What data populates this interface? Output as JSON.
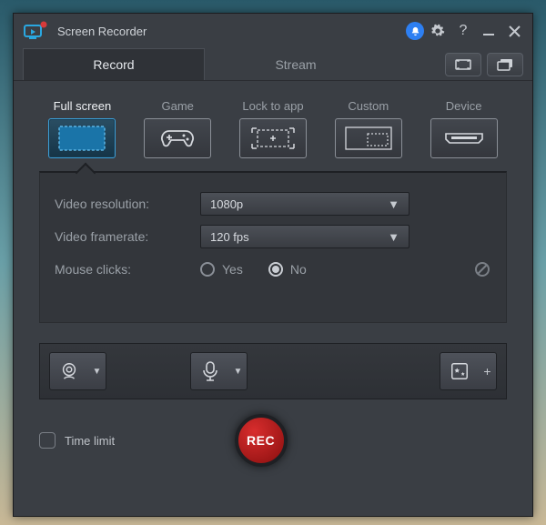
{
  "title": "Screen Recorder",
  "tabs": {
    "record": "Record",
    "stream": "Stream"
  },
  "modes": {
    "full_screen": "Full screen",
    "game": "Game",
    "lock_to_app": "Lock to app",
    "custom": "Custom",
    "device": "Device"
  },
  "settings": {
    "video_resolution_label": "Video resolution:",
    "video_resolution_value": "1080p",
    "video_framerate_label": "Video framerate:",
    "video_framerate_value": "120 fps",
    "mouse_clicks_label": "Mouse clicks:",
    "mouse_yes": "Yes",
    "mouse_no": "No",
    "mouse_selected": "No"
  },
  "footer": {
    "time_limit_label": "Time limit",
    "rec_label": "REC"
  }
}
